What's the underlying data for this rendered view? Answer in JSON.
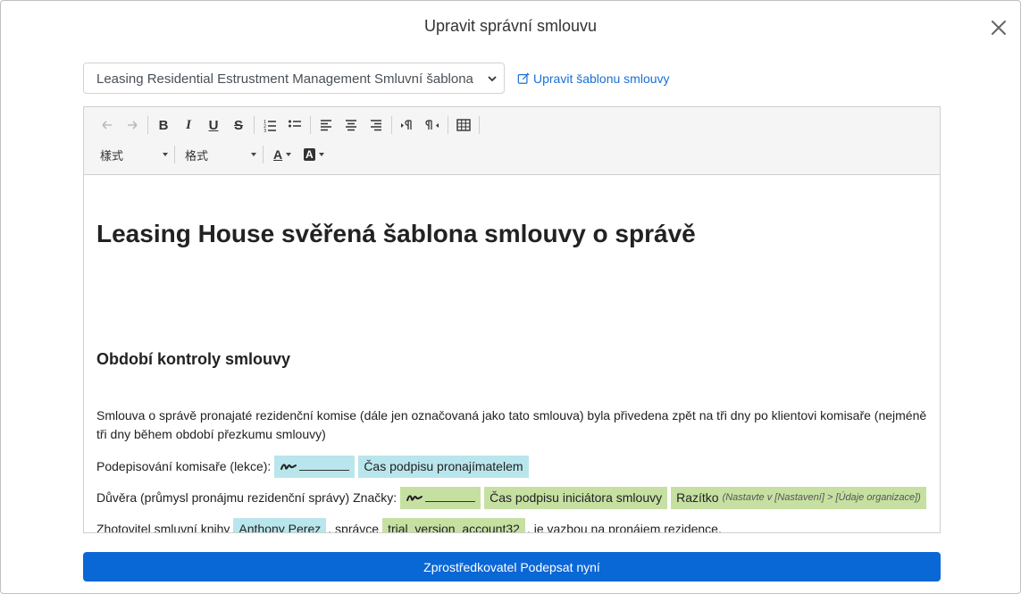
{
  "modal": {
    "title": "Upravit správní smlouvu"
  },
  "template_select": {
    "selected": "Leasing Residential Estrustment Management Smluvní šablona"
  },
  "edit_template_link": {
    "label": "Upravit šablonu smlouvy"
  },
  "toolbar": {
    "row1": [
      "undo-icon",
      "redo-icon",
      "bold-icon",
      "italic-icon",
      "underline-icon",
      "strikethrough-icon",
      "ordered-list-icon",
      "bullet-list-icon",
      "align-left-icon",
      "align-center-icon",
      "align-right-icon",
      "ltr-icon",
      "rtl-icon",
      "table-icon"
    ],
    "bold_glyph": "B",
    "italic_glyph": "I",
    "underline_glyph": "U",
    "strike_glyph": "S",
    "style_dropdown": "樣式",
    "format_dropdown": "格式",
    "text_color_glyph": "A",
    "bg_color_glyph": "A"
  },
  "document": {
    "title": "Leasing House svěřená šablona smlouvy o správě",
    "section_heading": "Období kontroly smlouvy",
    "paragraph1": "Smlouva o správě pronajaté rezidenční komise (dále jen označovaná jako tato smlouva) byla přivedena zpět na tři dny po klientovi komisaře (nejméně tři dny během období přezkumu smlouvy)",
    "line1": {
      "label": "Podepisování komisaře (lekce):",
      "signature_time": "Čas podpisu pronajímatelem"
    },
    "line2": {
      "label": "Důvěra (průmysl pronájmu rezidenční správy) Značky:",
      "signature_time": "Čas podpisu iniciátora smlouvy",
      "stamp": "Razítko",
      "stamp_hint": "(Nastavte v [Nastavení] > [Údaje organizace])"
    },
    "line3": {
      "label": "Zhotovitel smluvní knihy",
      "person": "Anthony Perez",
      "middle": ", správce",
      "account": "trial_version_account32",
      "tail": ", je vazbou na pronájem rezidence."
    }
  },
  "sign_button": {
    "label": "Zprostředkovatel Podepsat nyní"
  },
  "colors": {
    "primary": "#0a67d6",
    "link": "#1a6fd6",
    "chip_cyan": "#b9e6ec",
    "chip_green": "#c6e0a2"
  }
}
